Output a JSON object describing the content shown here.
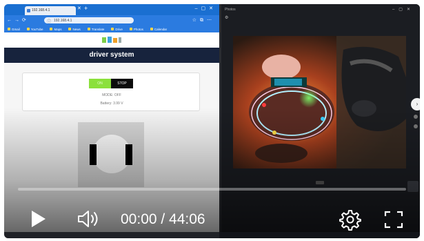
{
  "browser": {
    "tab_title": "192.168.4.1",
    "address": "192.168.4.1",
    "bookmarks": [
      "Gmail",
      "YouTube",
      "Maps",
      "News",
      "Translate",
      "Drive",
      "Photos",
      "Calendar"
    ]
  },
  "page": {
    "title": "driver system",
    "on_button": "ON",
    "stop_button": "STOP",
    "mode_text": "MODE: OFF",
    "battery_text": "Battery: 3.99 V"
  },
  "viewer": {
    "title": "Photos"
  },
  "player": {
    "time": "00:00 / 44:06",
    "progress": 0,
    "accent": "#ff2b2b",
    "icons": [
      "play-icon",
      "volume-icon",
      "gear-icon",
      "fullscreen-icon"
    ]
  }
}
